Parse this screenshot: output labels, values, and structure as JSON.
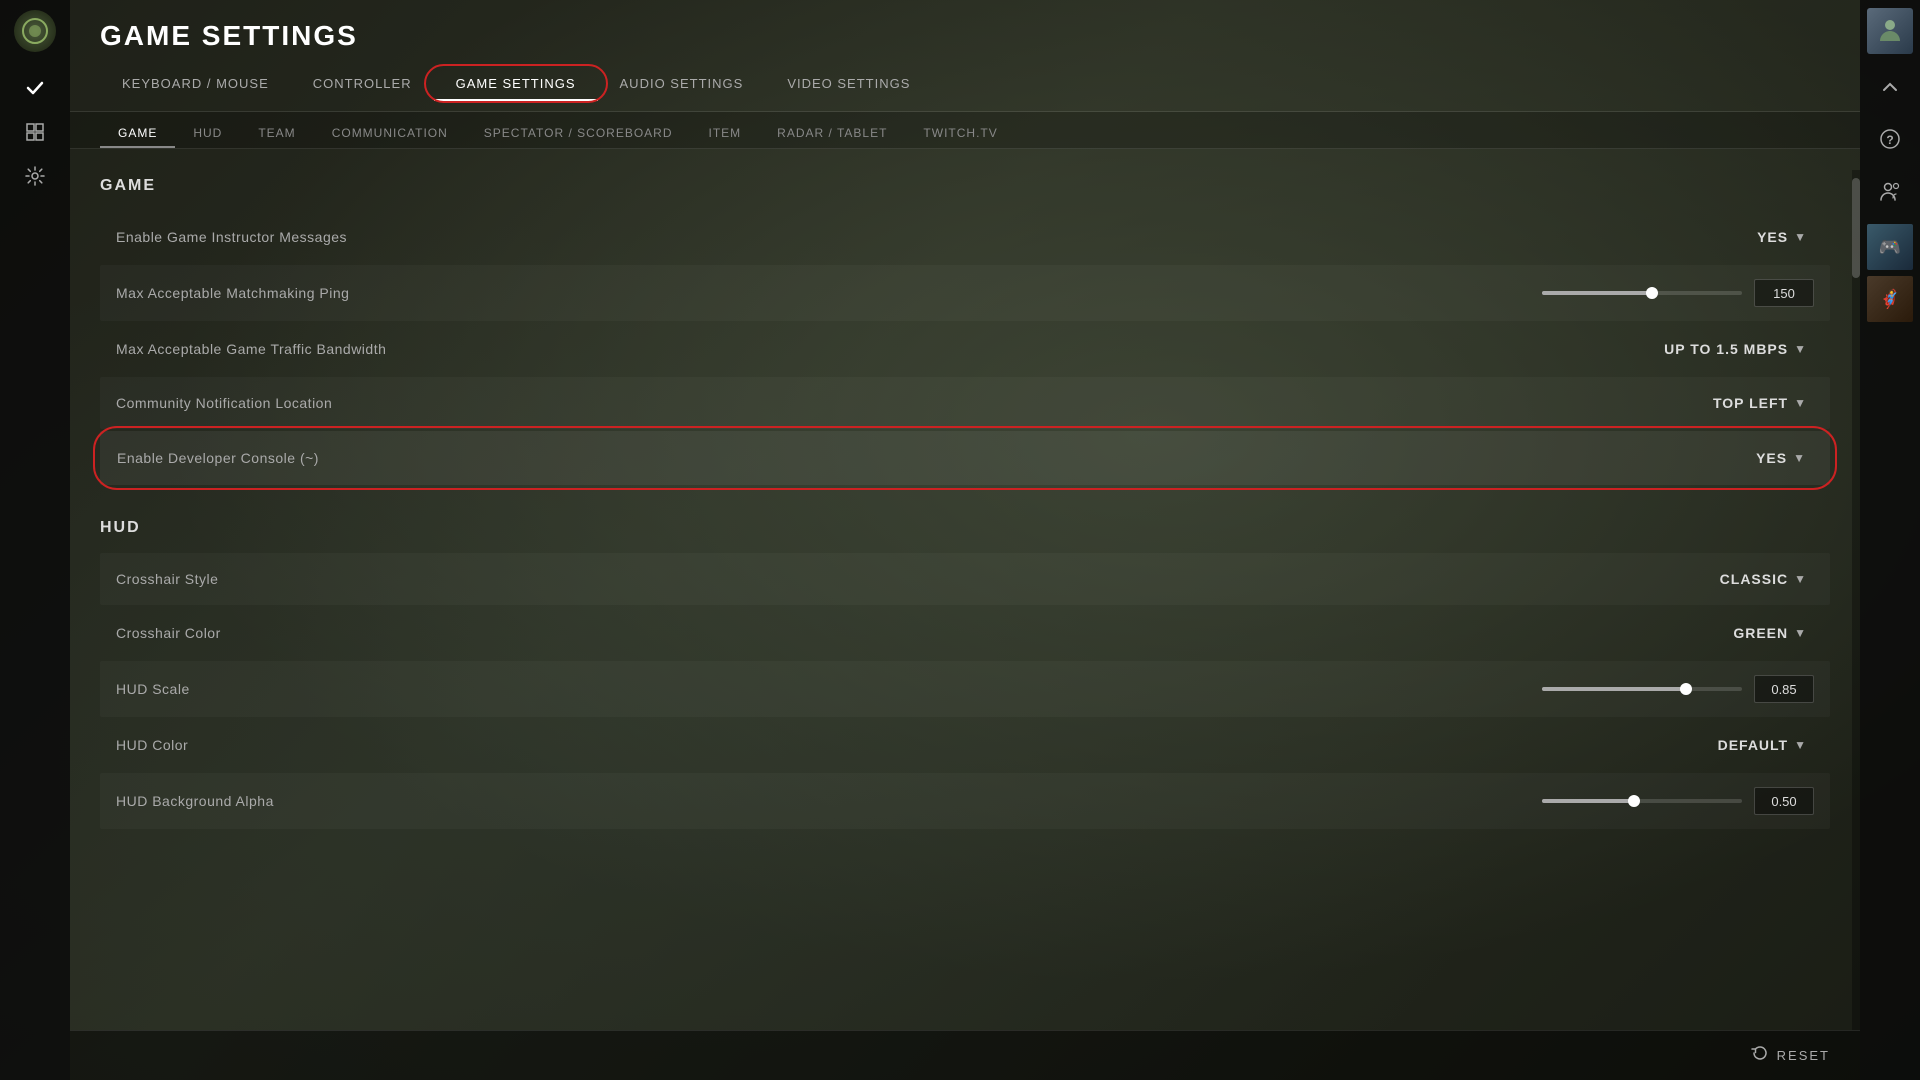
{
  "page": {
    "title": "GAME SETTINGS"
  },
  "top_nav": {
    "items": [
      {
        "label": "Keyboard / Mouse",
        "active": false
      },
      {
        "label": "Controller",
        "active": false
      },
      {
        "label": "Game Settings",
        "active": true
      },
      {
        "label": "Audio Settings",
        "active": false
      },
      {
        "label": "Video Settings",
        "active": false
      }
    ]
  },
  "sub_nav": {
    "items": [
      {
        "label": "Game",
        "active": true
      },
      {
        "label": "Hud",
        "active": false
      },
      {
        "label": "Team",
        "active": false
      },
      {
        "label": "Communication",
        "active": false
      },
      {
        "label": "Spectator / Scoreboard",
        "active": false
      },
      {
        "label": "Item",
        "active": false
      },
      {
        "label": "Radar / Tablet",
        "active": false
      },
      {
        "label": "Twitch.tv",
        "active": false
      }
    ]
  },
  "sections": [
    {
      "header": "Game",
      "settings": [
        {
          "type": "dropdown",
          "label": "Enable Game Instructor Messages",
          "value": "YES",
          "highlighted": false
        },
        {
          "type": "slider",
          "label": "Max Acceptable Matchmaking Ping",
          "value": "150",
          "fill_percent": 55
        },
        {
          "type": "dropdown",
          "label": "Max Acceptable Game Traffic Bandwidth",
          "value": "UP TO 1.5 MBPS",
          "highlighted": false
        },
        {
          "type": "dropdown",
          "label": "Community Notification Location",
          "value": "TOP LEFT",
          "highlighted": false
        },
        {
          "type": "dropdown",
          "label": "Enable Developer Console (~)",
          "value": "YES",
          "highlighted": true
        }
      ]
    },
    {
      "header": "Hud",
      "settings": [
        {
          "type": "dropdown",
          "label": "Crosshair Style",
          "value": "CLASSIC",
          "highlighted": false
        },
        {
          "type": "dropdown",
          "label": "Crosshair Color",
          "value": "GREEN",
          "highlighted": false
        },
        {
          "type": "slider",
          "label": "HUD Scale",
          "value": "0.85",
          "fill_percent": 72
        },
        {
          "type": "dropdown",
          "label": "HUD Color",
          "value": "DEFAULT",
          "highlighted": false
        },
        {
          "type": "slider",
          "label": "HUD Background Alpha",
          "value": "0.50",
          "fill_percent": 46
        }
      ]
    }
  ],
  "bottom_bar": {
    "reset_label": "RESET"
  },
  "sidebar": {
    "icons": [
      "◎",
      "✓",
      "⬛",
      "⚙"
    ]
  },
  "right_sidebar": {
    "icons": [
      "▲",
      "?",
      "👤"
    ]
  }
}
